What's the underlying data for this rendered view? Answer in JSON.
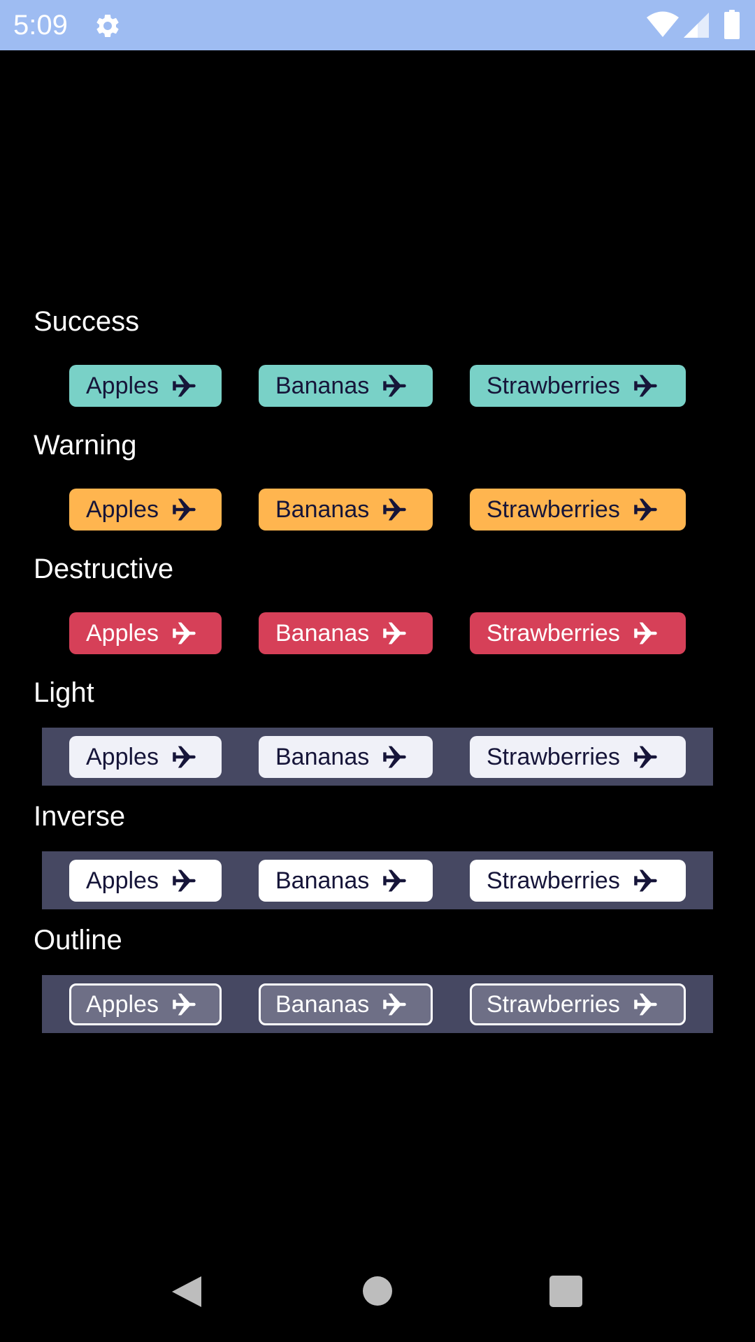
{
  "status_bar": {
    "time": "5:09",
    "icons": [
      "gear-icon",
      "wifi-icon",
      "signal-icon",
      "battery-icon"
    ],
    "background": "#9ebcf2"
  },
  "chip_icon": "airplane-icon",
  "sections": [
    {
      "title": "Success",
      "chips": [
        "Apples",
        "Bananas",
        "Strawberries"
      ],
      "chip_color": "#79d1c7",
      "text_color": "#161539"
    },
    {
      "title": "Warning",
      "chips": [
        "Apples",
        "Bananas",
        "Strawberries"
      ],
      "chip_color": "#ffb54f",
      "text_color": "#161539"
    },
    {
      "title": "Destructive",
      "chips": [
        "Apples",
        "Bananas",
        "Strawberries"
      ],
      "chip_color": "#d64058",
      "text_color": "#ffffff"
    },
    {
      "title": "Light",
      "chips": [
        "Apples",
        "Bananas",
        "Strawberries"
      ],
      "chip_color": "#f0f1f8",
      "text_color": "#161539",
      "panel_color": "#464862"
    },
    {
      "title": "Inverse",
      "chips": [
        "Apples",
        "Bananas",
        "Strawberries"
      ],
      "chip_color": "#ffffff",
      "text_color": "#161539",
      "panel_color": "#464862"
    },
    {
      "title": "Outline",
      "chips": [
        "Apples",
        "Bananas",
        "Strawberries"
      ],
      "chip_color": "#6e6f86",
      "text_color": "#ffffff",
      "border_color": "#ffffff",
      "panel_color": "#464862"
    }
  ],
  "nav_bar": {
    "buttons": [
      "back-icon",
      "home-icon",
      "recents-icon"
    ]
  }
}
